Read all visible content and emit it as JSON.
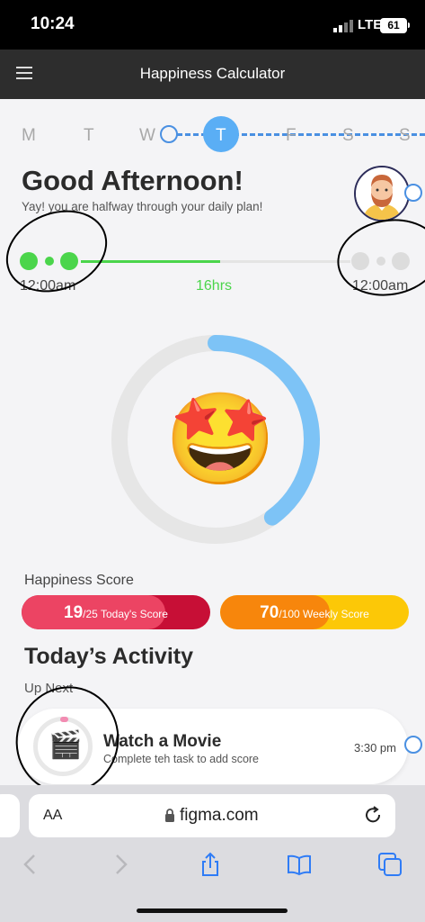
{
  "status_bar": {
    "time": "10:24",
    "network": "LTE",
    "battery": "61"
  },
  "header": {
    "title": "Happiness Calculator",
    "menu_icon": "hamburger-menu-icon"
  },
  "days": {
    "labels": [
      "M",
      "T",
      "W",
      "T",
      "F",
      "S",
      "S"
    ],
    "selected_index": 3,
    "colors": {
      "inactive": "#a8a8a8",
      "active_bg": "#5aaef5",
      "line": "#4a90e2"
    }
  },
  "greeting": {
    "title": "Good Afternoon!",
    "subtitle": "Yay! you are halfway through your daily plan!",
    "avatar_icon": "bearded-man-avatar-icon"
  },
  "timeline": {
    "start": "12:00am",
    "elapsed": "16hrs",
    "end": "12:00am",
    "progress": 0.5,
    "active_color": "#4bd54b"
  },
  "progress_ring": {
    "progress": 0.4,
    "color": "#7dc3f6",
    "track_color": "#e6e6e6",
    "emoji": "🤩"
  },
  "scores": {
    "title": "Happiness Score",
    "today": {
      "value": "19",
      "rest": "/25 Today's Score",
      "fraction": 0.76,
      "color": "#ec4463"
    },
    "weekly": {
      "value": "70",
      "rest": "/100 Weekly Score",
      "fraction": 0.58,
      "color": "#f7860c"
    }
  },
  "activity": {
    "section_title": "Today’s Activity",
    "up_next": "Up Next",
    "item": {
      "name": "Watch a Movie",
      "description": "Complete teh task to add score",
      "time": "3:30 pm",
      "icon": "🎬"
    }
  },
  "browser": {
    "aa_label": "AA",
    "url": "figma.com"
  }
}
